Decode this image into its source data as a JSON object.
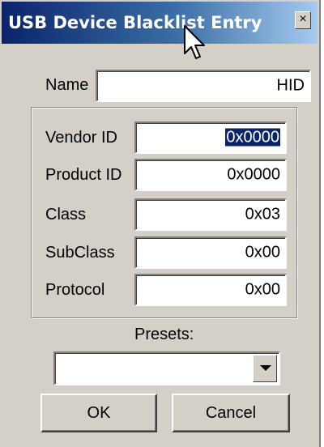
{
  "window": {
    "title": "USB Device Blacklist Entry",
    "close_glyph": "×"
  },
  "form": {
    "name_label": "Name",
    "name_value": "HID",
    "fields": [
      {
        "label": "Vendor ID",
        "value": "0x0000",
        "selected": true
      },
      {
        "label": "Product ID",
        "value": "0x0000"
      },
      {
        "label": "Class",
        "value": "0x03"
      },
      {
        "label": "SubClass",
        "value": "0x00"
      },
      {
        "label": "Protocol",
        "value": "0x00"
      }
    ],
    "presets_label": "Presets:",
    "presets_value": ""
  },
  "buttons": {
    "ok": "OK",
    "cancel": "Cancel"
  },
  "colors": {
    "title_gradient_start": "#0a246a",
    "title_gradient_end": "#a6caf0",
    "dialog_bg": "#d4d0c8",
    "selection_bg": "#0a246a"
  },
  "icons": {
    "close": "close-icon",
    "dropdown": "chevron-down-icon",
    "cursor": "mouse-pointer-icon"
  }
}
